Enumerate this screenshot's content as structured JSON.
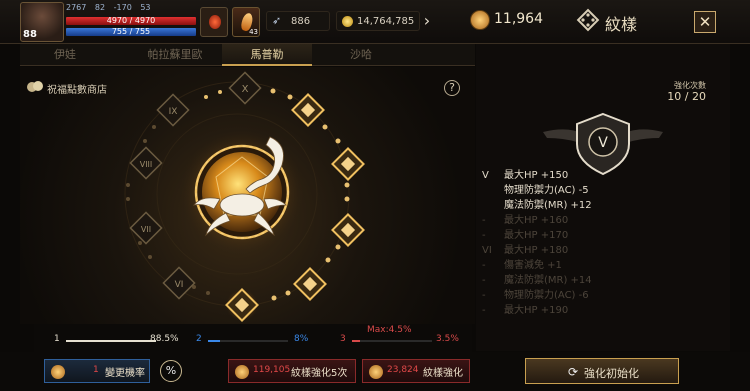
{
  "player": {
    "level": "88",
    "stats": [
      "2767",
      "82",
      "-170",
      "53"
    ],
    "hp": "4970 / 4970",
    "mp": "755 / 755"
  },
  "inventory": {
    "potion_count": "",
    "item_count": "43"
  },
  "currency": {
    "feathers": "886",
    "gold": "14,764,785",
    "gems": "11,964"
  },
  "page": {
    "title": "紋樣",
    "close_label": "✕"
  },
  "tabs": [
    {
      "label": "伊娃",
      "active": false
    },
    {
      "label": "帕拉蘇里歐",
      "active": false
    },
    {
      "label": "馬普勒",
      "active": true
    },
    {
      "label": "沙哈",
      "active": false
    }
  ],
  "center": {
    "shop_label": "祝福點數商店",
    "help_label": "?",
    "roman_levels": [
      "X",
      "IX",
      "VIII",
      "VII",
      "VI"
    ]
  },
  "right": {
    "count_label": "強化次數",
    "count_value": "10 / 20",
    "emblem_level": "V",
    "stats": [
      {
        "lvl": "V",
        "text": "最大HP +150",
        "state": "bright"
      },
      {
        "lvl": "",
        "text": "物理防禦力(AC) -5",
        "state": "bright"
      },
      {
        "lvl": "",
        "text": "魔法防禦(MR) +12",
        "state": "bright"
      },
      {
        "lvl": "-",
        "text": "最大HP +160",
        "state": "dim"
      },
      {
        "lvl": "-",
        "text": "最大HP +170",
        "state": "dim"
      },
      {
        "lvl": "VI",
        "text": "最大HP +180",
        "state": "dim"
      },
      {
        "lvl": "-",
        "text": "傷害減免 +1",
        "state": "dim"
      },
      {
        "lvl": "-",
        "text": "魔法防禦(MR) +14",
        "state": "dim"
      },
      {
        "lvl": "-",
        "text": "物理防禦力(AC) -6",
        "state": "dim"
      },
      {
        "lvl": "-",
        "text": "最大HP +190",
        "state": "dim"
      }
    ]
  },
  "probability": {
    "p1_index": "1",
    "p1_value": "88.5%",
    "p2_index": "2",
    "p2_value": "8%",
    "p3_index": "3",
    "p3_value": "3.5%",
    "max_label": "Max:4.5%"
  },
  "buttons": {
    "rate_cost": "1",
    "rate_label": "變更機率",
    "pct_label": "%",
    "enhance5_cost": "119,105",
    "enhance5_label": "紋樣強化5次",
    "enhance_cost": "23,824",
    "enhance_label": "紋樣強化",
    "reset_label": "強化初始化"
  },
  "colors": {
    "accent_gold": "#c9a050",
    "hp_red": "#e03030",
    "mp_blue": "#3a77d8",
    "danger_red": "#e04848"
  }
}
